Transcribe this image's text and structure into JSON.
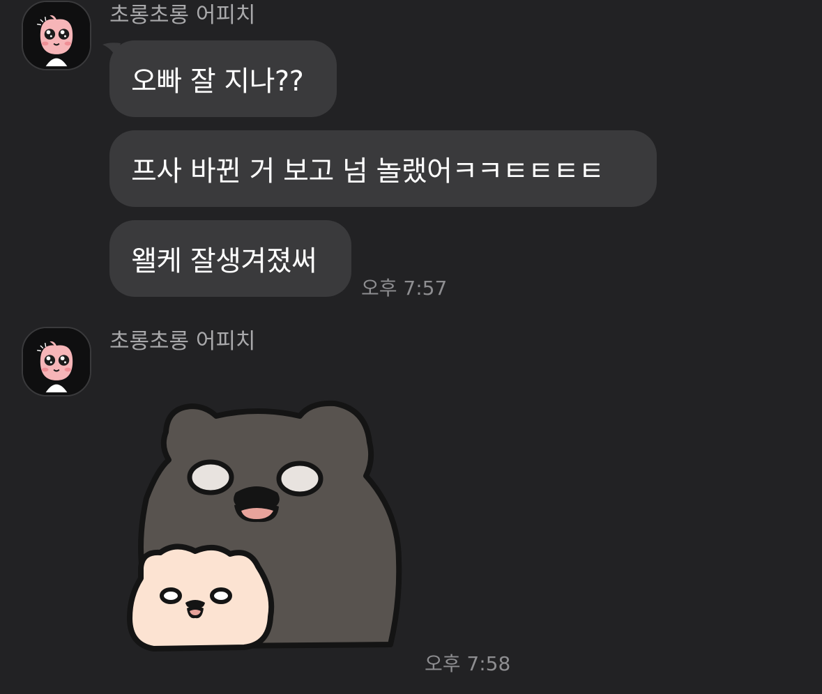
{
  "messages": [
    {
      "sender": "초롱초롱 어피치",
      "bubbles": [
        "오빠 잘 지나??",
        "프사 바뀐 거 보고 넘 놀랬어ㅋㅋㅌㅌㅌㅌ",
        "왤케 잘생겨졌써"
      ],
      "time": "오후 7:57"
    },
    {
      "sender": "초롱초롱 어피치",
      "sticker": "bear-sticker",
      "time": "오후 7:58"
    }
  ],
  "icons": {
    "avatar": "apeach-avatar-icon",
    "sticker": "two-bears-sticker"
  },
  "colors": {
    "background": "#222224",
    "bubble": "#3a3a3c",
    "sender_name": "#a9a9ab",
    "timestamp": "#8e8e91",
    "big_bear": "#58534f",
    "small_bear": "#fce3d2"
  }
}
